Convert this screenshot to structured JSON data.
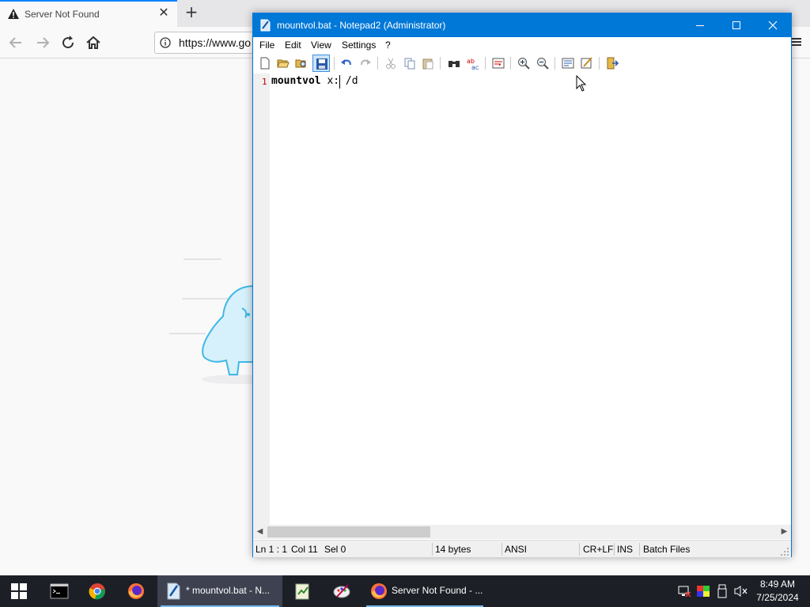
{
  "browser": {
    "tab_title": "Server Not Found",
    "url": "https://www.go"
  },
  "notepad": {
    "window_title": "mountvol.bat - Notepad2 (Administrator)",
    "menu": [
      "File",
      "Edit",
      "View",
      "Settings",
      "?"
    ],
    "editor": {
      "line_number": "1",
      "keyword": "mountvol",
      "rest": " x: /d"
    },
    "status": {
      "position": "Ln 1 : 1",
      "column": "Col 11",
      "selection": "Sel 0",
      "size": "14 bytes",
      "encoding": "ANSI",
      "line_ending": "CR+LF",
      "mode": "INS",
      "scheme": "Batch Files"
    },
    "accent_color": "#0078d7"
  },
  "taskbar": {
    "notepad_label": "* mountvol.bat - N...",
    "firefox_label": "Server Not Found - ...",
    "time": "8:49 AM",
    "date": "7/25/2024"
  }
}
